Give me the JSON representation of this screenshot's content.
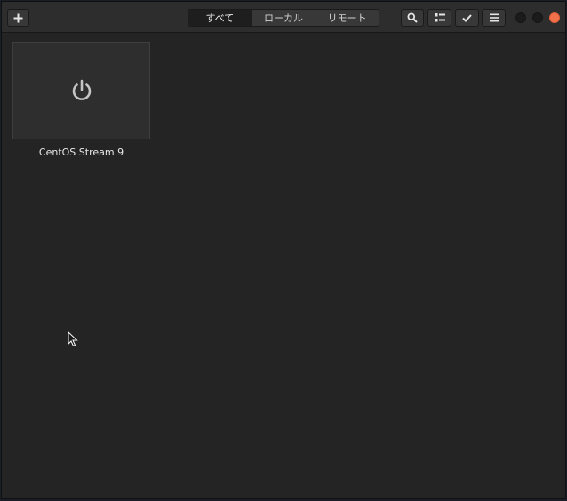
{
  "header": {
    "new_button_icon": "plus-icon",
    "tabs": [
      {
        "label": "すべて",
        "active": true
      },
      {
        "label": "ローカル",
        "active": false
      },
      {
        "label": "リモート",
        "active": false
      }
    ],
    "search_button_icon": "search-icon",
    "view_button_icon": "list-view-icon",
    "select_button_icon": "checkmark-icon",
    "menu_button_icon": "hamburger-menu-icon"
  },
  "window_controls": {
    "close_color": "#f2704a"
  },
  "boxes": [
    {
      "name": "CentOS Stream 9",
      "icon": "power-icon"
    }
  ]
}
